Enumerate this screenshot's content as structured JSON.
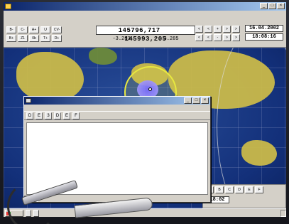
{
  "colors": {
    "titlebar": "#0a246a",
    "ocean": "#13307a",
    "land": "#c9b94a",
    "coverage": "#e8e840",
    "footprint": "#7a6cff"
  },
  "main_window": {
    "title": "",
    "controls": [
      "_",
      "□",
      "×"
    ]
  },
  "menu": [],
  "panel": {
    "qth": "",
    "keys": [
      "B-",
      "C-",
      "A+",
      "U",
      "CV-",
      "B+",
      "Z1",
      "0b",
      "T+",
      "D+"
    ],
    "freq_labels": [],
    "downlink": "145796,717",
    "uplink": "145993,205",
    "doppler_down": "-3.283",
    "doppler_up": "3.285",
    "step_buttons": [
      "<",
      "<",
      "+",
      ">",
      ">",
      "<",
      "<",
      "-",
      ">",
      ">"
    ],
    "date_label": "",
    "date": "16.04.2002",
    "time": "18:08:16"
  },
  "map_panel": {
    "keys": [
      "A",
      "B",
      "C",
      "D",
      "E",
      "F"
    ],
    "time": "18:02"
  },
  "status": [],
  "hyperterminal": {
    "title": "",
    "menu": [],
    "tools": [
      "D",
      "E",
      "3",
      "D",
      "E",
      "F"
    ],
    "lines": [],
    "status": []
  },
  "taskbar": {
    "start": "",
    "tasks": [],
    "tray_time": ""
  }
}
